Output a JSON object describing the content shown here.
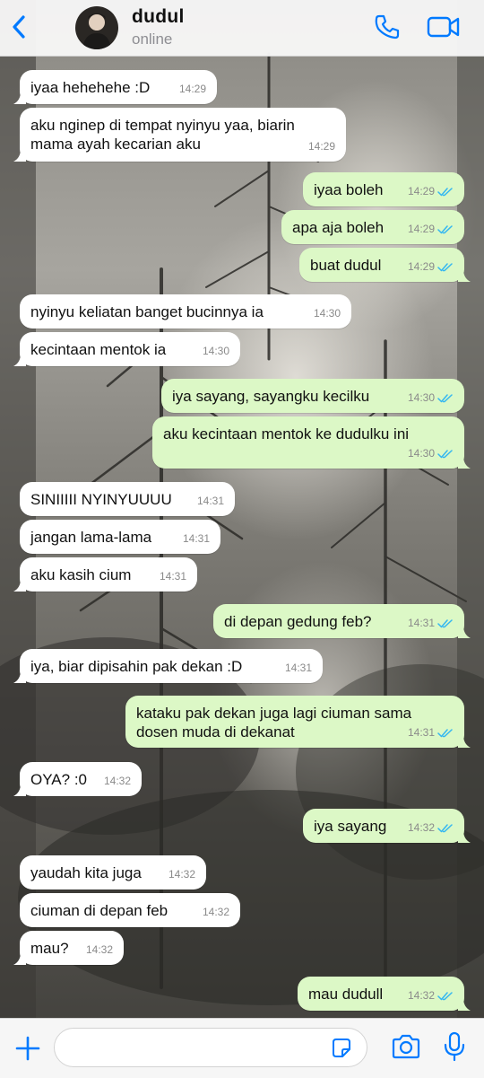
{
  "contact": {
    "name": "dudul",
    "status": "online"
  },
  "composer": {
    "placeholder": ""
  },
  "colors": {
    "accent": "#007aff",
    "outgoing": "#dcf8c6",
    "incoming": "#ffffff",
    "read_ticks": "#34b7f1"
  },
  "icons": {
    "back": "chevron-left-icon",
    "call": "phone-icon",
    "video": "video-camera-icon",
    "attach": "plus-icon",
    "sticker": "sticker-icon",
    "camera": "camera-icon",
    "mic": "microphone-icon"
  },
  "messages": [
    {
      "dir": "in",
      "text": "iyaa hehehehe :D",
      "time": "14:29"
    },
    {
      "dir": "in",
      "text": "aku nginep di tempat nyinyu yaa, biarin\nmama ayah kecarian aku",
      "time": "14:29"
    },
    {
      "dir": "out",
      "text": "iyaa boleh",
      "time": "14:29",
      "read": true
    },
    {
      "dir": "out",
      "text": "apa aja boleh",
      "time": "14:29",
      "read": true
    },
    {
      "dir": "out",
      "text": "buat dudul",
      "time": "14:29",
      "read": true
    },
    {
      "dir": "in",
      "text": "nyinyu keliatan banget bucinnya ia",
      "time": "14:30"
    },
    {
      "dir": "in",
      "text": "kecintaan mentok ia",
      "time": "14:30"
    },
    {
      "dir": "out",
      "text": "iya sayang, sayangku kecilku",
      "time": "14:30",
      "read": true
    },
    {
      "dir": "out",
      "text": "aku kecintaan mentok ke dudulku ini",
      "time": "14:30",
      "read": true
    },
    {
      "dir": "in",
      "text": "SINIIIII NYINYUUUU",
      "time": "14:31"
    },
    {
      "dir": "in",
      "text": "jangan lama-lama",
      "time": "14:31"
    },
    {
      "dir": "in",
      "text": "aku kasih cium",
      "time": "14:31"
    },
    {
      "dir": "out",
      "text": "di depan gedung feb?",
      "time": "14:31",
      "read": true
    },
    {
      "dir": "in",
      "text": "iya, biar dipisahin pak dekan :D",
      "time": "14:31"
    },
    {
      "dir": "out",
      "text": "kataku pak dekan juga lagi ciuman sama\ndosen muda di dekanat",
      "time": "14:31",
      "read": true
    },
    {
      "dir": "in",
      "text": "OYA? :0",
      "time": "14:32"
    },
    {
      "dir": "out",
      "text": "iya sayang",
      "time": "14:32",
      "read": true
    },
    {
      "dir": "in",
      "text": "yaudah kita juga",
      "time": "14:32"
    },
    {
      "dir": "in",
      "text": "ciuman di depan feb",
      "time": "14:32"
    },
    {
      "dir": "in",
      "text": "mau?",
      "time": "14:32"
    },
    {
      "dir": "out",
      "text": "mau dudull",
      "time": "14:32",
      "read": true
    }
  ]
}
